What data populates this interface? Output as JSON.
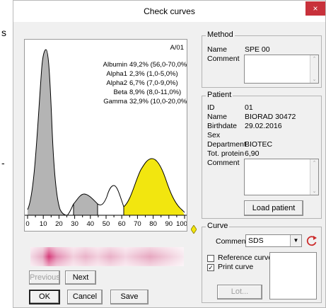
{
  "window": {
    "title": "Check curves",
    "close_glyph": "×"
  },
  "background_text": {
    "chars": [
      "s",
      "-"
    ]
  },
  "plot": {
    "sample_id": "A/01",
    "results": [
      {
        "name": "Albumin",
        "value": "49,2% (56,0-70,0%)"
      },
      {
        "name": "Alpha1",
        "value": "2,3% (1,0-5,0%)"
      },
      {
        "name": "Alpha2",
        "value": "6,7% (7,0-9,0%)"
      },
      {
        "name": "Beta",
        "value": "8,9% (8,0-11,0%)"
      },
      {
        "name": "Gamma",
        "value": "32,9% (10,0-20,0%)"
      }
    ],
    "x_ticks": [
      "0",
      "10",
      "20",
      "30",
      "40",
      "50",
      "60",
      "70",
      "80",
      "90",
      "100"
    ]
  },
  "chart_data": {
    "type": "area",
    "title": "",
    "xlabel": "",
    "ylabel": "",
    "xlim": [
      0,
      100
    ],
    "series": [
      {
        "name": "Albumin",
        "value_percent": 49.2,
        "reference": "56,0-70,0%"
      },
      {
        "name": "Alpha1",
        "value_percent": 2.3,
        "reference": "1,0-5,0%"
      },
      {
        "name": "Alpha2",
        "value_percent": 6.7,
        "reference": "7,0-9,0%"
      },
      {
        "name": "Beta",
        "value_percent": 8.9,
        "reference": "8,0-11,0%"
      },
      {
        "name": "Gamma",
        "value_percent": 32.9,
        "reference": "10,0-20,0%"
      }
    ],
    "colors": {
      "albumin": "#b4b4b4",
      "gamma": "#f2e60f",
      "curve": "#000000"
    }
  },
  "buttons": {
    "previous": "Previous",
    "next": "Next",
    "ok": "OK",
    "cancel": "Cancel",
    "save": "Save",
    "load_patient": "Load patient",
    "lot": "Lot..."
  },
  "method": {
    "group_label": "Method",
    "name_label": "Name",
    "name_value": "SPE 00",
    "comment_label": "Comment"
  },
  "patient": {
    "group_label": "Patient",
    "fields": [
      {
        "label": "ID",
        "value": "01"
      },
      {
        "label": "Name",
        "value": "BIORAD 30472"
      },
      {
        "label": "Birthdate",
        "value": "29.02.2016"
      },
      {
        "label": "Sex",
        "value": ""
      },
      {
        "label": "Department",
        "value": "BIOTEC"
      },
      {
        "label": "Tot. protein",
        "value": "6,90"
      }
    ],
    "comment_label": "Comment"
  },
  "curve": {
    "group_label": "Curve",
    "comment_label": "Comment",
    "comment_value": "SDS",
    "reference_curve_label": "Reference curve",
    "reference_curve_checked": false,
    "print_curve_label": "Print curve",
    "print_curve_checked": true,
    "check_glyph": "✓"
  },
  "colors": {
    "close_button": "#c8313b",
    "accent_icon": "#cc2a2a",
    "gel_band": "#d63a78"
  }
}
